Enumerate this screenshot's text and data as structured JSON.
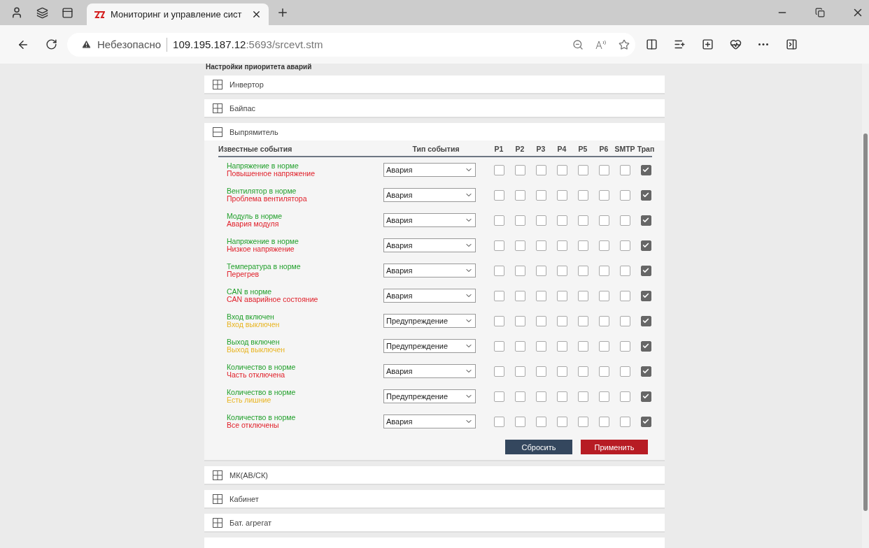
{
  "browser": {
    "tab": {
      "title": "Мониторинг и управление сист",
      "selected": true
    },
    "security": "Небезопасно",
    "url_host": "109.195.187.12",
    "url_rest": ":5693/srcevt.stm"
  },
  "page": {
    "heading": "Настройки приоритета аварий",
    "sections": [
      {
        "title": "Инвертор",
        "expanded": false
      },
      {
        "title": "Байпас",
        "expanded": false
      },
      {
        "title": "Выпрямитель",
        "expanded": true,
        "columns": {
          "events": "Известные события",
          "type": "Тип события",
          "channels": [
            "P1",
            "P2",
            "P3",
            "P4",
            "P5",
            "P6",
            "SMTP",
            "Трап"
          ]
        },
        "events": [
          {
            "normal": "Напряжение в норме",
            "fault": "Повышенное напряжение",
            "color": "#e0202a",
            "type": "Авария",
            "checks": [
              false,
              false,
              false,
              false,
              false,
              false,
              false,
              true
            ]
          },
          {
            "normal": "Вентилятор в норме",
            "fault": "Проблема вентилятора",
            "color": "#e0202a",
            "type": "Авария",
            "checks": [
              false,
              false,
              false,
              false,
              false,
              false,
              false,
              true
            ]
          },
          {
            "normal": "Модуль в норме",
            "fault": "Авария модуля",
            "color": "#e0202a",
            "type": "Авария",
            "checks": [
              false,
              false,
              false,
              false,
              false,
              false,
              false,
              true
            ]
          },
          {
            "normal": "Напряжение в норме",
            "fault": "Низкое напряжение",
            "color": "#e0202a",
            "type": "Авария",
            "checks": [
              false,
              false,
              false,
              false,
              false,
              false,
              false,
              true
            ]
          },
          {
            "normal": "Температура в норме",
            "fault": "Перегрев",
            "color": "#e0202a",
            "type": "Авария",
            "checks": [
              false,
              false,
              false,
              false,
              false,
              false,
              false,
              true
            ]
          },
          {
            "normal": "CAN в норме",
            "fault": "CAN аварийное состояние",
            "color": "#e0202a",
            "type": "Авария",
            "checks": [
              false,
              false,
              false,
              false,
              false,
              false,
              false,
              true
            ]
          },
          {
            "normal": "Вход включен",
            "fault": "Вход выключен",
            "color": "#e8b420",
            "type": "Предупреждение",
            "checks": [
              false,
              false,
              false,
              false,
              false,
              false,
              false,
              true
            ]
          },
          {
            "normal": "Выход включен",
            "fault": "Выход выключен",
            "color": "#e8b420",
            "type": "Предупреждение",
            "checks": [
              false,
              false,
              false,
              false,
              false,
              false,
              false,
              true
            ]
          },
          {
            "normal": "Количество в норме",
            "fault": "Часть отключена",
            "color": "#e0202a",
            "type": "Авария",
            "checks": [
              false,
              false,
              false,
              false,
              false,
              false,
              false,
              true
            ]
          },
          {
            "normal": "Количество в норме",
            "fault": "Есть лишние",
            "color": "#e8b420",
            "type": "Предупреждение",
            "checks": [
              false,
              false,
              false,
              false,
              false,
              false,
              false,
              true
            ]
          },
          {
            "normal": "Количество в норме",
            "fault": "Все отключены",
            "color": "#e0202a",
            "type": "Авария",
            "checks": [
              false,
              false,
              false,
              false,
              false,
              false,
              false,
              true
            ]
          }
        ],
        "buttons": [
          {
            "label": "Сбросить",
            "kind": "reset"
          },
          {
            "label": "Применить",
            "kind": "apply"
          }
        ]
      },
      {
        "title": "МК(АВ/СК)",
        "expanded": false
      },
      {
        "title": "Кабинет",
        "expanded": false
      },
      {
        "title": "Бат. агрегат",
        "expanded": false
      }
    ]
  }
}
